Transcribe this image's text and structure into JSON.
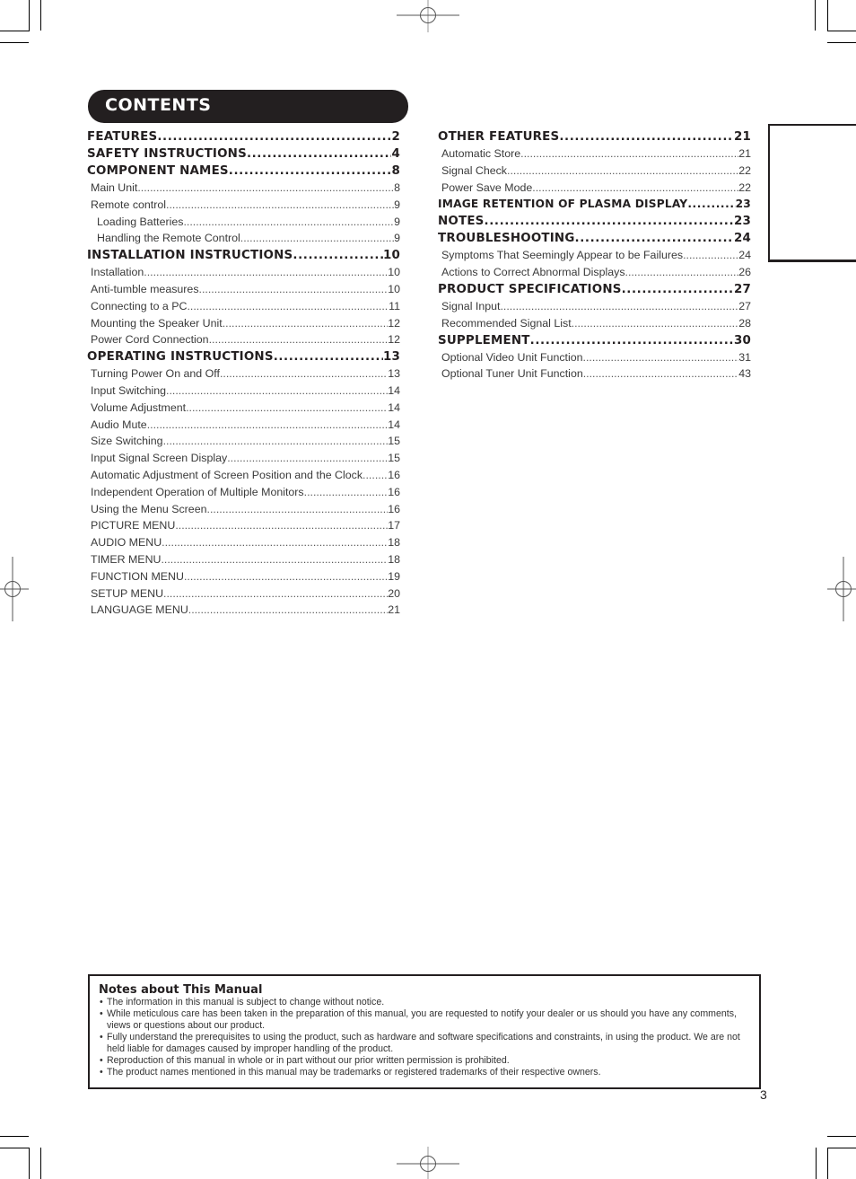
{
  "title": "CONTENTS",
  "left_column": [
    {
      "level": 1,
      "label": "FEATURES",
      "page": "2"
    },
    {
      "level": 1,
      "label": "SAFETY INSTRUCTIONS",
      "page": "4"
    },
    {
      "level": 1,
      "label": "COMPONENT NAMES",
      "page": "8"
    },
    {
      "level": 2,
      "label": "Main Unit",
      "page": "8"
    },
    {
      "level": 2,
      "label": "Remote control",
      "page": "9"
    },
    {
      "level": 3,
      "label": "Loading Batteries",
      "page": "9"
    },
    {
      "level": 3,
      "label": "Handling the Remote Control",
      "page": "9"
    },
    {
      "level": 1,
      "label": "INSTALLATION INSTRUCTIONS",
      "page": "10"
    },
    {
      "level": 2,
      "label": "Installation",
      "page": "10"
    },
    {
      "level": 2,
      "label": "Anti-tumble measures",
      "page": "10"
    },
    {
      "level": 2,
      "label": "Connecting to a PC",
      "page": "11"
    },
    {
      "level": 2,
      "label": "Mounting the Speaker Unit",
      "page": "12"
    },
    {
      "level": 2,
      "label": "Power Cord Connection",
      "page": "12"
    },
    {
      "level": 1,
      "label": "OPERATING INSTRUCTIONS",
      "page": "13"
    },
    {
      "level": 2,
      "label": "Turning Power On and Off",
      "page": "13"
    },
    {
      "level": 2,
      "label": "Input Switching",
      "page": "14"
    },
    {
      "level": 2,
      "label": "Volume Adjustment",
      "page": "14"
    },
    {
      "level": 2,
      "label": "Audio Mute",
      "page": "14"
    },
    {
      "level": 2,
      "label": "Size Switching",
      "page": "15"
    },
    {
      "level": 2,
      "label": "Input Signal Screen Display",
      "page": "15"
    },
    {
      "level": 2,
      "label": "Automatic Adjustment of Screen Position and the Clock",
      "page": "16"
    },
    {
      "level": 2,
      "label": "Independent Operation of Multiple Monitors",
      "page": "16"
    },
    {
      "level": 2,
      "label": "Using the Menu Screen",
      "page": "16"
    },
    {
      "level": 2,
      "label": "PICTURE MENU",
      "page": "17"
    },
    {
      "level": 2,
      "label": "AUDIO MENU",
      "page": "18"
    },
    {
      "level": 2,
      "label": "TIMER MENU",
      "page": "18"
    },
    {
      "level": 2,
      "label": "FUNCTION MENU",
      "page": "19"
    },
    {
      "level": 2,
      "label": "SETUP MENU",
      "page": "20"
    },
    {
      "level": 2,
      "label": "LANGUAGE MENU",
      "page": "21"
    }
  ],
  "right_column": [
    {
      "level": 1,
      "label": "OTHER FEATURES",
      "page": "21"
    },
    {
      "level": 2,
      "label": "Automatic Store",
      "page": "21"
    },
    {
      "level": 2,
      "label": "Signal Check",
      "page": "22"
    },
    {
      "level": 2,
      "label": "Power Save Mode",
      "page": "22"
    },
    {
      "level": 1,
      "label": "IMAGE RETENTION OF PLASMA DISPLAY",
      "page": "23",
      "small": true
    },
    {
      "level": 1,
      "label": "NOTES",
      "page": "23"
    },
    {
      "level": 1,
      "label": "TROUBLESHOOTING",
      "page": "24"
    },
    {
      "level": 2,
      "label": "Symptoms That Seemingly Appear to be Failures",
      "page": "24"
    },
    {
      "level": 2,
      "label": "Actions to Correct Abnormal Displays",
      "page": "26"
    },
    {
      "level": 1,
      "label": "PRODUCT SPECIFICATIONS",
      "page": "27"
    },
    {
      "level": 2,
      "label": "Signal Input",
      "page": "27"
    },
    {
      "level": 2,
      "label": "Recommended Signal List",
      "page": "28"
    },
    {
      "level": 1,
      "label": "SUPPLEMENT",
      "page": "30"
    },
    {
      "level": 2,
      "label": "Optional Video Unit Function",
      "page": "31"
    },
    {
      "level": 2,
      "label": "Optional Tuner Unit Function",
      "page": "43"
    }
  ],
  "notes": {
    "title": "Notes about This Manual",
    "items": [
      "The information in this manual is subject to change without notice.",
      "While meticulous care has been taken in the preparation of this manual, you are requested to notify your dealer or us should you have any comments, views or questions about our product.",
      "Fully understand the prerequisites to using the product, such as hardware and software specifications and constraints, in using the product.  We are not held liable for damages caused by improper handling of the product.",
      "Reproduction of this manual in whole or in part without our prior written permission is prohibited.",
      "The product names mentioned in this manual may be trademarks or registered trademarks of their respective owners."
    ]
  },
  "page_number": "3"
}
